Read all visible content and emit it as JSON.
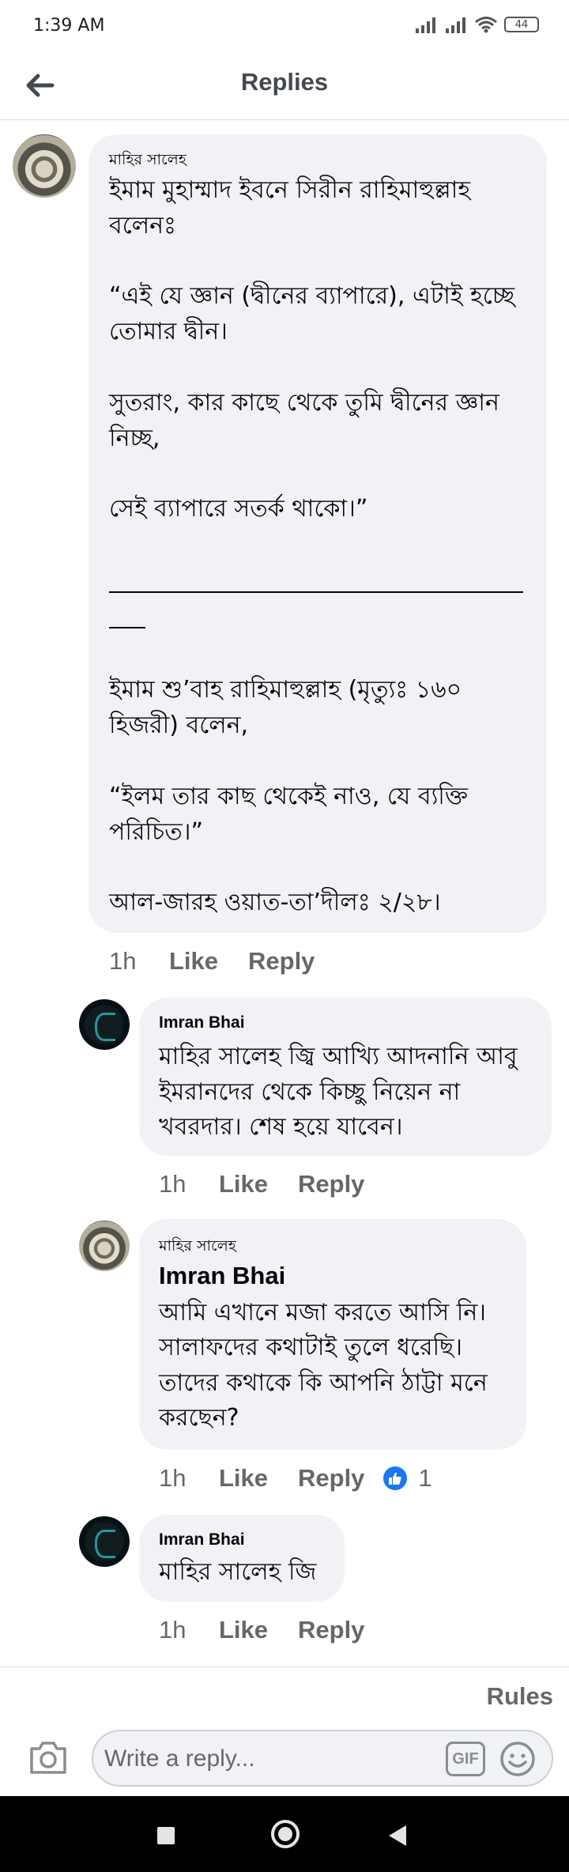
{
  "status_bar": {
    "time": "1:39 AM",
    "battery": "44"
  },
  "header": {
    "title": "Replies",
    "back_icon": "arrow-left-icon"
  },
  "comments": [
    {
      "author": "মাহির সালেহ",
      "lines": [
        "ইমাম মুহাম্মাদ ইবনে সিরীন রাহিমাহুল্লাহ",
        "বলেনঃ",
        "“এই যে জ্ঞান (দ্বীনের ব্যাপারে), এটাই হচ্ছে",
        "তোমার দ্বীন।",
        "সুতরাং, কার কাছে থেকে তুমি দ্বীনের জ্ঞান",
        "নিচ্ছ,",
        "সেই ব্যাপারে সতর্ক থাকো।”",
        "ইমাম শু’বাহ রাহিমাহুল্লাহ (মৃত্যুঃ ১৬০",
        "হিজরী) বলেন,",
        "“ইলম তার কাছ থেকেই নাও, যে ব্যক্তি",
        "পরিচিত।”",
        "আল-জারহ ওয়াত-তা’দীলঃ ২/২৮।"
      ],
      "time": "1h",
      "like": "Like",
      "reply": "Reply"
    },
    {
      "author": "Imran Bhai",
      "lines": [
        "মাহির সালেহ জ্বি আখ্যি আদনানি আবু",
        "ইমরানদের থেকে কিচ্ছু নিয়েন না",
        "খবরদার। শেষ হয়ে যাবেন।"
      ],
      "time": "1h",
      "like": "Like",
      "reply": "Reply"
    },
    {
      "author": "মাহির সালেহ",
      "tag": "Imran Bhai",
      "lines": [
        "আমি এখানে মজা করতে আসি নি।",
        "সালাফদের কথাটাই তুলে ধরেছি।",
        "তাদের কথাকে কি আপনি ঠাট্টা মনে",
        "করছেন?"
      ],
      "time": "1h",
      "like": "Like",
      "reply": "Reply",
      "reaction_count": "1"
    },
    {
      "author": "Imran Bhai",
      "lines": [
        "মাহির সালেহ জি"
      ],
      "time": "1h",
      "like": "Like",
      "reply": "Reply"
    }
  ],
  "composer": {
    "rules": "Rules",
    "placeholder": "Write a reply...",
    "gif": "GIF",
    "camera_icon": "camera-icon",
    "emoji_icon": "emoji-icon"
  },
  "colors": {
    "bubble": "#f0f2f5",
    "meta": "#65676b",
    "like_blue": "#1877f2",
    "header_text": "#444950"
  }
}
